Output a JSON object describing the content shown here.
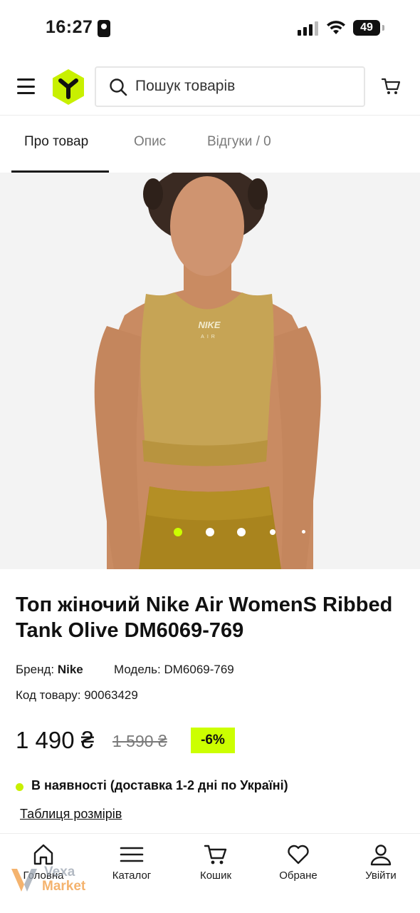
{
  "status_bar": {
    "time": "16:27",
    "battery": "49"
  },
  "header": {
    "search_placeholder": "Пошук товарів"
  },
  "tabs": [
    {
      "label": "Про товар",
      "active": true
    },
    {
      "label": "Опис",
      "active": false
    },
    {
      "label": "Відгуки / 0",
      "active": false
    }
  ],
  "gallery": {
    "slide_count": 5,
    "active_index": 0
  },
  "product": {
    "title": "Топ жіночий Nike Air WomenS Ribbed Tank Olive DM6069-769",
    "brand_label": "Бренд:",
    "brand": "Nike",
    "model_label": "Модель:",
    "model": "DM6069-769",
    "code_label": "Код товару:",
    "code": "90063429",
    "price": "1 490 ₴",
    "old_price": "1 590 ₴",
    "discount": "-6%",
    "stock": "В наявності (доставка 1-2 дні по Україні)",
    "size_table_link": "Таблиця розмірів"
  },
  "bottom_nav": [
    {
      "label": "Головна",
      "icon": "home-icon"
    },
    {
      "label": "Каталог",
      "icon": "catalog-icon"
    },
    {
      "label": "Кошик",
      "icon": "cart-icon"
    },
    {
      "label": "Обране",
      "icon": "heart-icon"
    },
    {
      "label": "Увійти",
      "icon": "user-icon"
    }
  ],
  "watermark": {
    "line1": "Vexa",
    "line2": "Market"
  },
  "colors": {
    "accent": "#ccff00",
    "stock_dot": "#c8f000",
    "text": "#111111",
    "muted": "#7a7a7a"
  }
}
